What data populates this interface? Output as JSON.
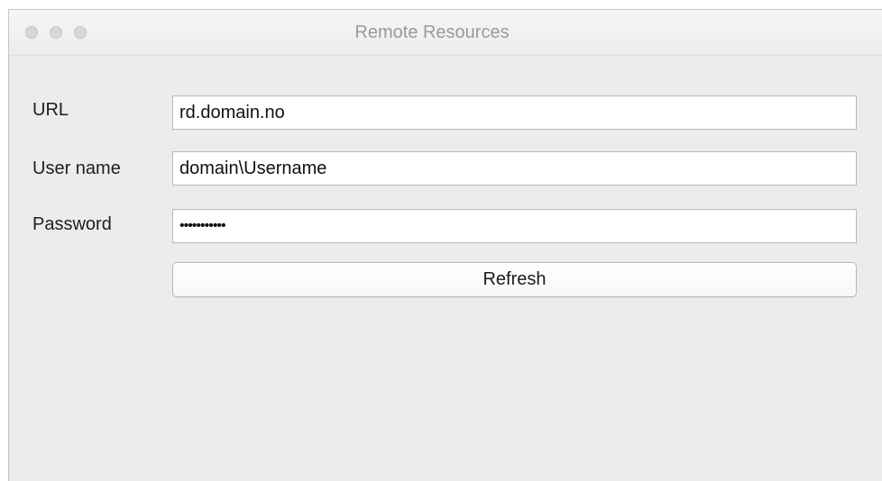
{
  "window": {
    "title": "Remote Resources"
  },
  "form": {
    "url_label": "URL",
    "url_value": "rd.domain.no",
    "username_label": "User name",
    "username_value": "domain\\Username",
    "password_label": "Password",
    "password_value": "•••••••••••",
    "refresh_label": "Refresh"
  }
}
